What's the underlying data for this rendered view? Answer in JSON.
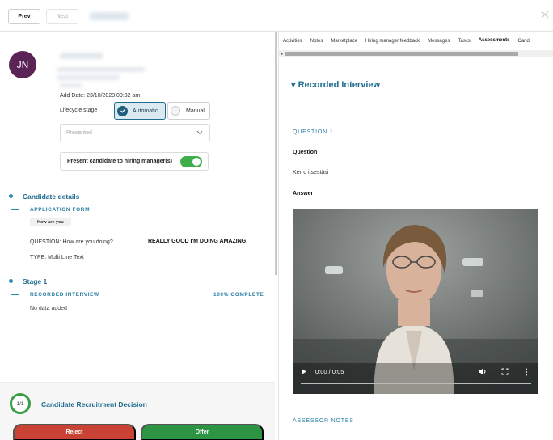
{
  "toolbar": {
    "prev_label": "Prev",
    "next_label": "Next"
  },
  "candidate": {
    "initials": "JN",
    "add_date": "Add Date: 23/10/2023 09:32 am",
    "lifecycle_label": "Lifecycle stage",
    "automatic_label": "Automatic",
    "manual_label": "Manual",
    "status_value": "Presented",
    "present_label": "Present candidate to hiring manager(s)"
  },
  "timeline": {
    "details_title": "Candidate details",
    "application_form": "APPLICATION FORM",
    "chip": "How are you",
    "question": "QUESTION: How are you doing?",
    "answer": "REALLY GOOD I'M DOING AMAZING!",
    "type": "TYPE: Multi Line Text",
    "stage_title": "Stage 1",
    "recorded_interview": "RECORDED INTERVIEW",
    "complete": "100% COMPLETE",
    "no_data": "No data added"
  },
  "decision": {
    "progress": "1/1",
    "title": "Candidate Recruitment Decision",
    "reject_label": "Reject",
    "offer_label": "Offer"
  },
  "tabs": [
    {
      "label": "Activities"
    },
    {
      "label": "Notes"
    },
    {
      "label": "Marketplace"
    },
    {
      "label": "Hiring manager feedback"
    },
    {
      "label": "Messages"
    },
    {
      "label": "Tasks"
    },
    {
      "label": "Assessments"
    },
    {
      "label": "Candi"
    }
  ],
  "right": {
    "section_title": "Recorded Interview",
    "question_header": "QUESTION 1",
    "question_label": "Question",
    "question_value": "Kerro itsestäsi",
    "answer_label": "Answer",
    "video_time": "0:00 / 0:05",
    "assessor_notes": "ASSESSOR NOTES"
  },
  "colors": {
    "accent": "#1f6d8e",
    "reject": "#c94334",
    "offer": "#2c9442",
    "avatar": "#5a2456"
  }
}
